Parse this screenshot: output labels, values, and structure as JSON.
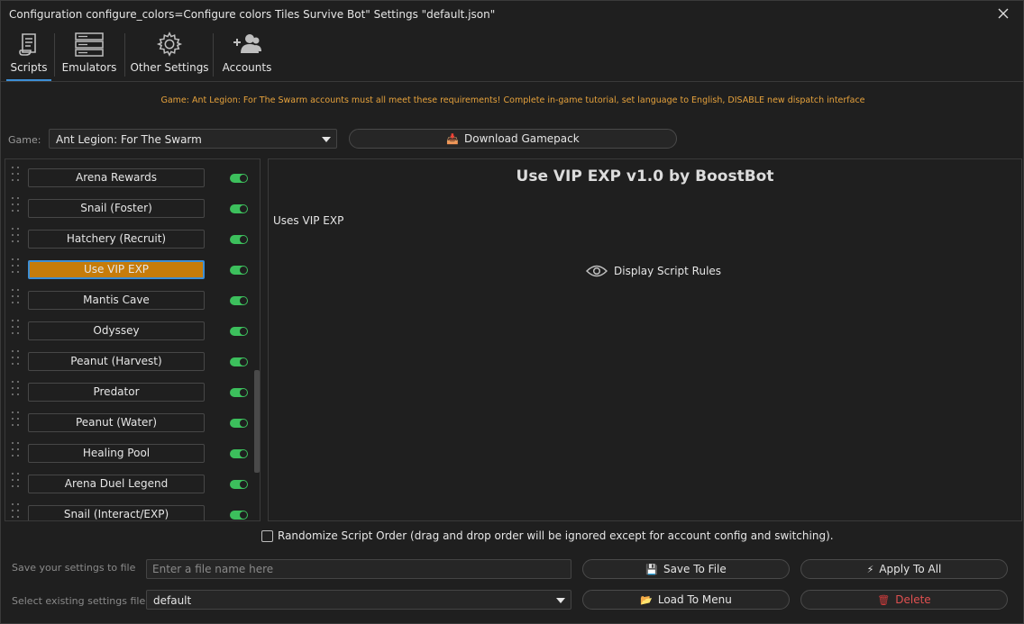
{
  "window": {
    "title": "Configuration configure_colors=Configure colors Tiles Survive Bot\" Settings \"default.json\""
  },
  "toolbar": {
    "items": [
      {
        "label": "Scripts",
        "icon": "scroll-icon",
        "active": true
      },
      {
        "label": "Emulators",
        "icon": "server-icon"
      },
      {
        "label": "Other Settings",
        "icon": "gear-icon"
      },
      {
        "label": "Accounts",
        "icon": "add-users-icon"
      }
    ]
  },
  "notice": "Game: Ant Legion: For The Swarm accounts must all meet these requirements! Complete in-game tutorial, set language to English, DISABLE new dispatch interface",
  "game": {
    "label": "Game:",
    "selected": "Ant Legion: For The Swarm",
    "download_label": "Download Gamepack"
  },
  "scripts": [
    {
      "label": "Arena Rewards",
      "enabled": true
    },
    {
      "label": "Snail (Foster)",
      "enabled": true
    },
    {
      "label": "Hatchery (Recruit)",
      "enabled": true
    },
    {
      "label": "Use VIP EXP",
      "enabled": true,
      "selected": true
    },
    {
      "label": "Mantis Cave",
      "enabled": true
    },
    {
      "label": "Odyssey",
      "enabled": true
    },
    {
      "label": "Peanut (Harvest)",
      "enabled": true
    },
    {
      "label": "Predator",
      "enabled": true
    },
    {
      "label": "Peanut (Water)",
      "enabled": true
    },
    {
      "label": "Healing Pool",
      "enabled": true
    },
    {
      "label": "Arena Duel Legend",
      "enabled": true
    },
    {
      "label": "Snail (Interact/EXP)",
      "enabled": true
    }
  ],
  "detail": {
    "title": "Use VIP EXP v1.0 by BoostBot",
    "description": "Uses VIP EXP",
    "rules_label": "Display Script Rules"
  },
  "randomize": {
    "label": "Randomize Script Order (drag and drop order will be ignored except for account config and switching).",
    "checked": false
  },
  "save": {
    "label": "Save your settings to file",
    "placeholder": "Enter a file name here",
    "save_button": "Save To File",
    "apply_button": "Apply To All"
  },
  "load": {
    "label": "Select existing settings file",
    "selected": "default",
    "load_button": "Load To Menu",
    "delete_button": "Delete"
  },
  "colors": {
    "accent": "#3d8fd6",
    "selected": "#c67c0a",
    "toggle_on": "#3cbf5c",
    "notice": "#e6a23c",
    "danger": "#e05050"
  }
}
